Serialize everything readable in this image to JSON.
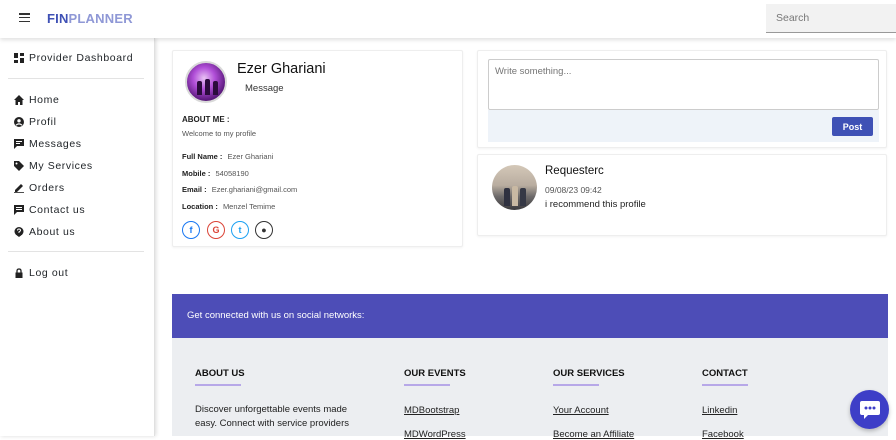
{
  "header": {
    "brand_part1": "FIN",
    "brand_part2": "PLANNER",
    "search_placeholder": "Search"
  },
  "sidebar": {
    "dashboard": "Provider Dashboard",
    "items": [
      {
        "label": "Home",
        "icon": "home-icon"
      },
      {
        "label": "Profil",
        "icon": "user-icon"
      },
      {
        "label": "Messages",
        "icon": "message-icon"
      },
      {
        "label": "My Services",
        "icon": "tag-icon"
      },
      {
        "label": "Orders",
        "icon": "pen-icon"
      },
      {
        "label": "Contact us",
        "icon": "chat-icon"
      },
      {
        "label": "About us",
        "icon": "question-icon"
      }
    ],
    "logout": "Log out"
  },
  "profile": {
    "name": "Ezer Ghariani",
    "message_label": "Message",
    "about_title": "ABOUT ME :",
    "about_text": "Welcome to my profile",
    "full_name_label": "Full Name :",
    "full_name": "Ezer Ghariani",
    "mobile_label": "Mobile :",
    "mobile": "54058190",
    "email_label": "Email :",
    "email": "Ezer.ghariani@gmail.com",
    "location_label": "Location :",
    "location": "Menzel Temime",
    "social": [
      {
        "name": "facebook-icon",
        "glyph": "f",
        "color": "#1877f2"
      },
      {
        "name": "google-icon",
        "glyph": "G",
        "color": "#db4437"
      },
      {
        "name": "twitter-icon",
        "glyph": "t",
        "color": "#1da1f2"
      },
      {
        "name": "github-icon",
        "glyph": "●",
        "color": "#333333"
      }
    ]
  },
  "composer": {
    "placeholder": "Write something...",
    "post_label": "Post"
  },
  "review": {
    "name": "Requesterc",
    "date": "09/08/23 09:42",
    "text": "i recommend this profile"
  },
  "footer": {
    "band_text": "Get connected with us on social networks:",
    "columns": [
      {
        "title": "ABOUT US",
        "text": "Discover unforgettable events made easy. Connect with service providers"
      },
      {
        "title": "OUR EVENTS",
        "links": [
          "MDBootstrap",
          "MDWordPress"
        ]
      },
      {
        "title": "OUR SERVICES",
        "links": [
          "Your Account",
          "Become an Affiliate"
        ]
      },
      {
        "title": "CONTACT",
        "links": [
          "Linkedin",
          "Facebook"
        ]
      }
    ]
  },
  "colors": {
    "accent": "#3f51b5",
    "footer_band": "#4d4db7",
    "chat_fab": "#3d3ec7"
  }
}
